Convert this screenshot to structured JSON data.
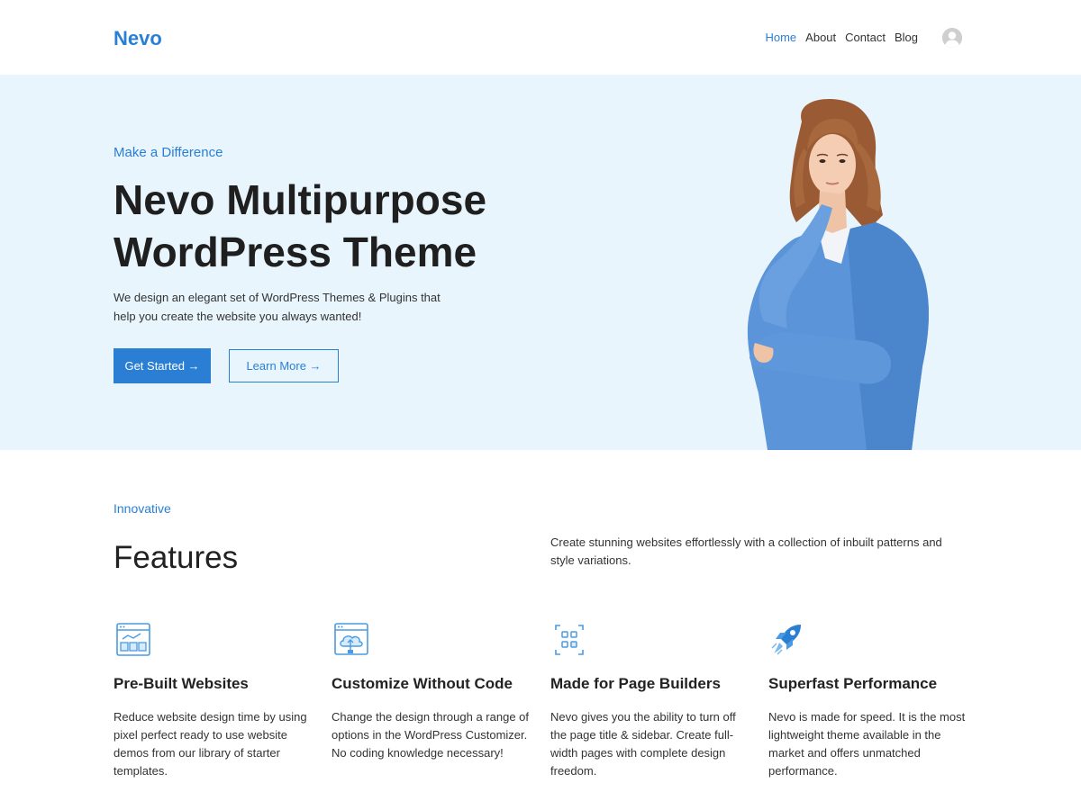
{
  "header": {
    "logo": "Nevo",
    "nav": [
      {
        "label": "Home",
        "active": true
      },
      {
        "label": "About",
        "active": false
      },
      {
        "label": "Contact",
        "active": false
      },
      {
        "label": "Blog",
        "active": false
      }
    ]
  },
  "hero": {
    "eyebrow": "Make a Difference",
    "title": "Nevo Multipurpose WordPress Theme",
    "description": "We design an elegant set of WordPress Themes & Plugins that help you create the website you always wanted!",
    "primary_button": "Get Started →",
    "secondary_button": "Learn More →",
    "background_color": "#e8f5fd"
  },
  "features": {
    "eyebrow": "Innovative",
    "title": "Features",
    "intro": "Create stunning websites effortlessly with a collection of inbuilt patterns and style variations.",
    "items": [
      {
        "icon": "website-template-icon",
        "title": "Pre-Built Websites",
        "text": "Reduce website design time by using pixel perfect ready to use website demos from our library of starter templates."
      },
      {
        "icon": "cloud-upload-icon",
        "title": "Customize Without Code",
        "text": "Change the design through a range of options in the WordPress Customizer. No coding knowledge necessary!"
      },
      {
        "icon": "page-builder-grid-icon",
        "title": "Made for Page Builders",
        "text": "Nevo gives you the ability to turn off the page title & sidebar. Create full-width pages with complete design freedom."
      },
      {
        "icon": "rocket-icon",
        "title": "Superfast Performance",
        "text": "Nevo is made for speed. It is the most lightweight theme available in the market and offers unmatched performance."
      }
    ]
  },
  "colors": {
    "accent": "#2a7fd4",
    "heading": "#1f1f1f",
    "hero_bg": "#e8f5fd"
  }
}
